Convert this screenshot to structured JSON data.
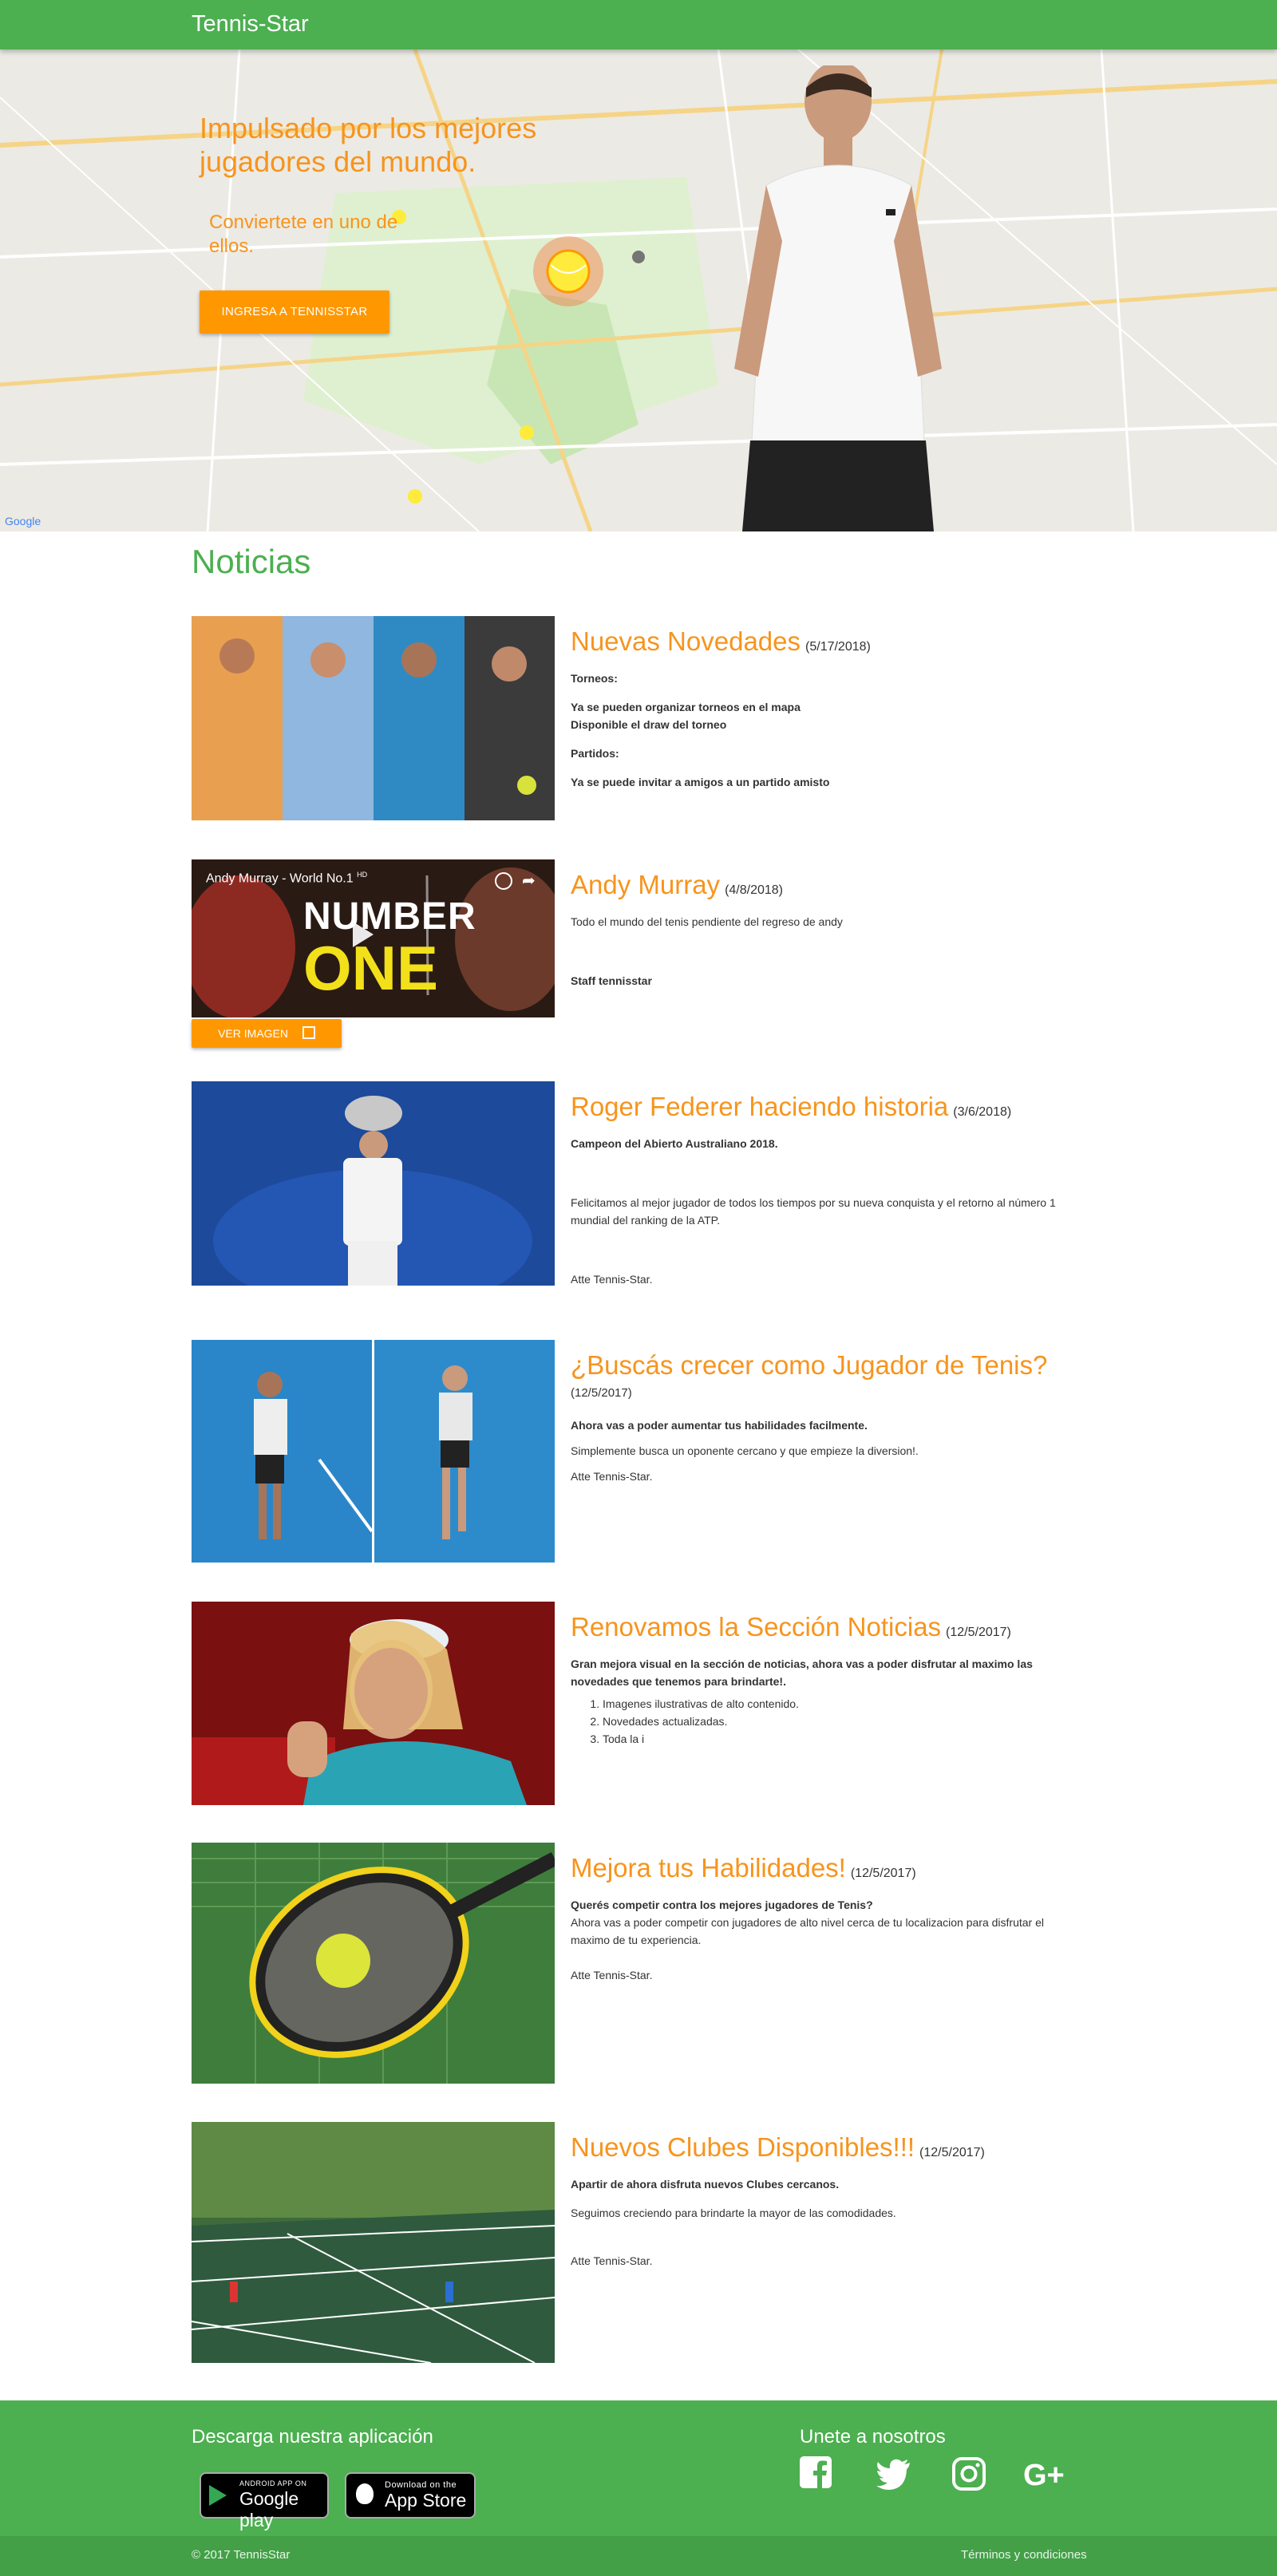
{
  "nav": {
    "brand": "Tennis-Star"
  },
  "hero": {
    "title": "Impulsado por los mejores jugadores del mundo.",
    "subtitle": "Conviertete en uno de ellos.",
    "cta": "INGRESA A TENNISSTAR"
  },
  "news": {
    "heading": "Noticias",
    "articles": [
      {
        "title": "Nuevas Novedades",
        "date": "(5/17/2018)",
        "l1": "Torneos:",
        "l2": "Ya se pueden organizar torneos en el mapa",
        "l3": "Disponible el draw del torneo",
        "l4": "Partidos:",
        "l5": "Ya se puede invitar a amigos a un partido amisto"
      },
      {
        "title": "Andy Murray",
        "date": "(4/8/2018)",
        "l1": "Todo el mundo del tenis pendiente del regreso de andy",
        "l2": "Staff tennisstar",
        "video_title": "Andy Murray - World No.1",
        "video_hd": "HD",
        "video_line1": "NUMBER",
        "video_line2": "ONE",
        "button": "VER IMAGEN"
      },
      {
        "title": "Roger Federer haciendo historia",
        "date": "(3/6/2018)",
        "l1": "Campeon del Abierto Australiano 2018.",
        "l2": "Felicitamos al mejor jugador de todos los tiempos por su nueva conquista y el retorno al número 1 mundial del ranking de la ATP.",
        "l3": "Atte Tennis-Star."
      },
      {
        "title": "¿Buscás crecer como Jugador de Tenis?",
        "date": "(12/5/2017)",
        "l1": "Ahora vas a poder aumentar tus habilidades facilmente.",
        "l2": "Simplemente busca un oponente cercano y que empieze la diversion!.",
        "l3": "Atte Tennis-Star."
      },
      {
        "title": "Renovamos la Sección Noticias",
        "date": "(12/5/2017)",
        "l1": "Gran mejora visual en la sección de noticias, ahora vas a poder disfrutar al maximo las novedades que tenemos para brindarte!.",
        "items": [
          "Imagenes ilustrativas de alto contenido.",
          "Novedades actualizadas.",
          "Toda la i"
        ]
      },
      {
        "title": "Mejora tus Habilidades!",
        "date": "(12/5/2017)",
        "l1": "Querés competir contra los mejores jugadores de Tenis?",
        "l2": "Ahora vas a poder competir con jugadores de alto nivel cerca de tu localizacion para disfrutar el maximo de tu experiencia.",
        "l3": "Atte Tennis-Star."
      },
      {
        "title": "Nuevos Clubes Disponibles!!!",
        "date": "(12/5/2017)",
        "l1": "Apartir de ahora disfruta nuevos Clubes cercanos.",
        "l2": "Seguimos creciendo para brindarte la mayor de las comodidades.",
        "l3": "Atte Tennis-Star."
      }
    ]
  },
  "footer": {
    "download": "Descarga nuestra aplicación",
    "join": "Unete a nosotros",
    "gplay_small": "ANDROID APP ON",
    "gplay_big": "Google play",
    "appstore_small": "Download on the",
    "appstore_big": "App Store",
    "copyright": "© 2017 TennisStar",
    "terms": "Términos y condiciones"
  },
  "colors": {
    "green": "#4caf50",
    "orange": "#f7941d",
    "button": "#ff9800"
  },
  "icons": [
    "image-icon",
    "facebook-icon",
    "twitter-icon",
    "instagram-icon",
    "google-plus-icon",
    "play-icon",
    "apple-icon"
  ]
}
